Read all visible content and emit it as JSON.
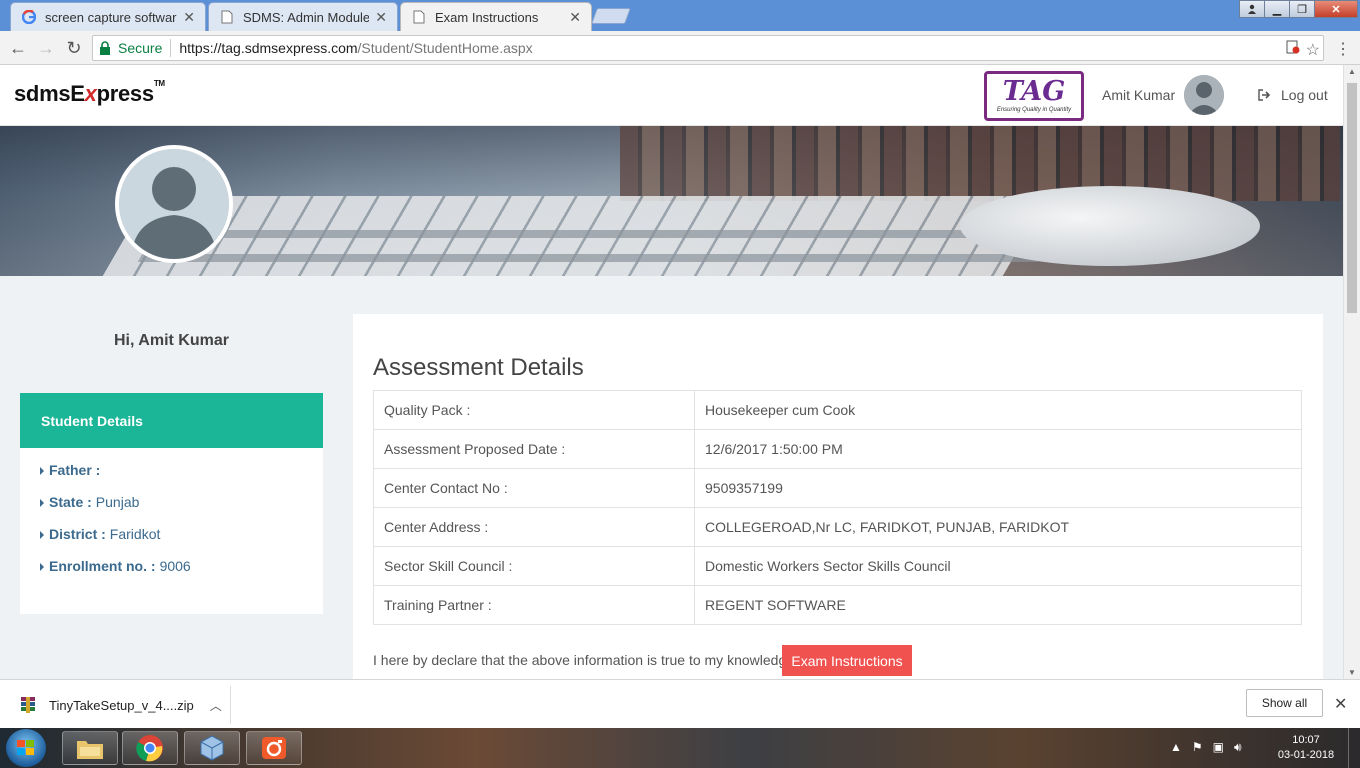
{
  "browser": {
    "tabs": [
      {
        "label": "screen capture software",
        "icon": "google-g-icon"
      },
      {
        "label": "SDMS: Admin Module",
        "icon": "page-icon"
      },
      {
        "label": "Exam Instructions",
        "icon": "page-icon",
        "active": true
      }
    ],
    "secure_label": "Secure",
    "url_host": "https://tag.sdmsexpress.com",
    "url_path": "/Student/StudentHome.aspx"
  },
  "header": {
    "logo_text": "sdmsE",
    "logo_x": "x",
    "logo_rest": "press",
    "logo_tm": "TM",
    "tag_logo_text": "TAG",
    "tag_logo_tagline": "Ensuring Quality in Quantity",
    "user_name": "Amit Kumar",
    "logout_label": "Log out"
  },
  "greeting": "Hi, Amit Kumar",
  "student_details": {
    "title": "Student Details",
    "items": [
      {
        "label": "Father :",
        "value": ""
      },
      {
        "label": "State :",
        "value": "Punjab"
      },
      {
        "label": "District :",
        "value": "Faridkot"
      },
      {
        "label": "Enrollment no. :",
        "value": "9006"
      }
    ]
  },
  "assessment": {
    "title": "Assessment Details",
    "rows": [
      {
        "label": "Quality Pack :",
        "value": "Housekeeper cum Cook"
      },
      {
        "label": "Assessment Proposed Date :",
        "value": "12/6/2017 1:50:00 PM"
      },
      {
        "label": "Center Contact No :",
        "value": "9509357199"
      },
      {
        "label": "Center Address :",
        "value": "COLLEGEROAD,Nr LC, FARIDKOT, PUNJAB, FARIDKOT"
      },
      {
        "label": "Sector Skill Council :",
        "value": "Domestic Workers Sector Skills Council"
      },
      {
        "label": "Training Partner :",
        "value": "REGENT SOFTWARE"
      }
    ],
    "declaration": "I here by declare that the above information is true to my knowledge.",
    "exam_button": "Exam Instructions"
  },
  "downloads": {
    "file_name": "TinyTakeSetup_v_4....zip",
    "show_all": "Show all"
  },
  "taskbar": {
    "time": "10:07",
    "date": "03-01-2018"
  },
  "colors": {
    "accent_green": "#1bb597",
    "button_red": "#f05250",
    "link_blue": "#3b6a8e"
  }
}
